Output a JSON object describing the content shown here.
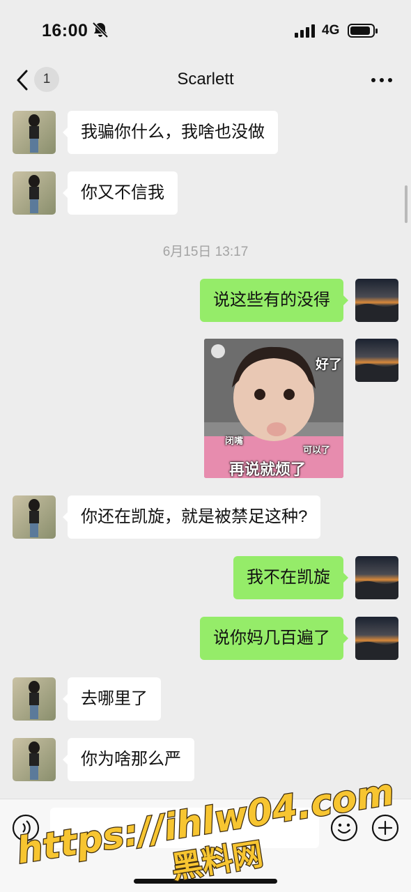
{
  "status_bar": {
    "time": "16:00",
    "network": "4G",
    "icons": [
      "bell-off-icon",
      "signal-icon",
      "battery-icon"
    ]
  },
  "nav": {
    "title": "Scarlett",
    "unread_count": "1",
    "icons": [
      "back-icon",
      "more-icon"
    ]
  },
  "messages": [
    {
      "side": "in",
      "text": "我骗你什么，我啥也没做"
    },
    {
      "side": "in",
      "text": "你又不信我"
    },
    {
      "type": "time",
      "text": "6月15日 13:17"
    },
    {
      "side": "out",
      "text": "说这些有的没得"
    },
    {
      "side": "out",
      "type": "sticker",
      "text_lines": [
        "好了",
        "闭嘴",
        "可以了",
        "再说就烦了"
      ]
    },
    {
      "side": "in",
      "text": "你还在凯旋，就是被禁足这种?"
    },
    {
      "side": "out",
      "text": "我不在凯旋"
    },
    {
      "side": "out",
      "text": "说你妈几百遍了"
    },
    {
      "side": "in",
      "text": "去哪里了"
    },
    {
      "side": "in",
      "text": "你为啥那么严"
    }
  ],
  "input_bar": {
    "placeholder": "",
    "icons": [
      "voice-icon",
      "emoji-icon",
      "plus-icon"
    ]
  },
  "watermark": {
    "line1": "https://ihlw04.com",
    "line2": "黑料网"
  },
  "colors": {
    "background": "#ededed",
    "incoming_bubble": "#ffffff",
    "outgoing_bubble": "#95ec69",
    "timestamp": "#a3a3a3",
    "watermark_fill": "#f7c531"
  }
}
